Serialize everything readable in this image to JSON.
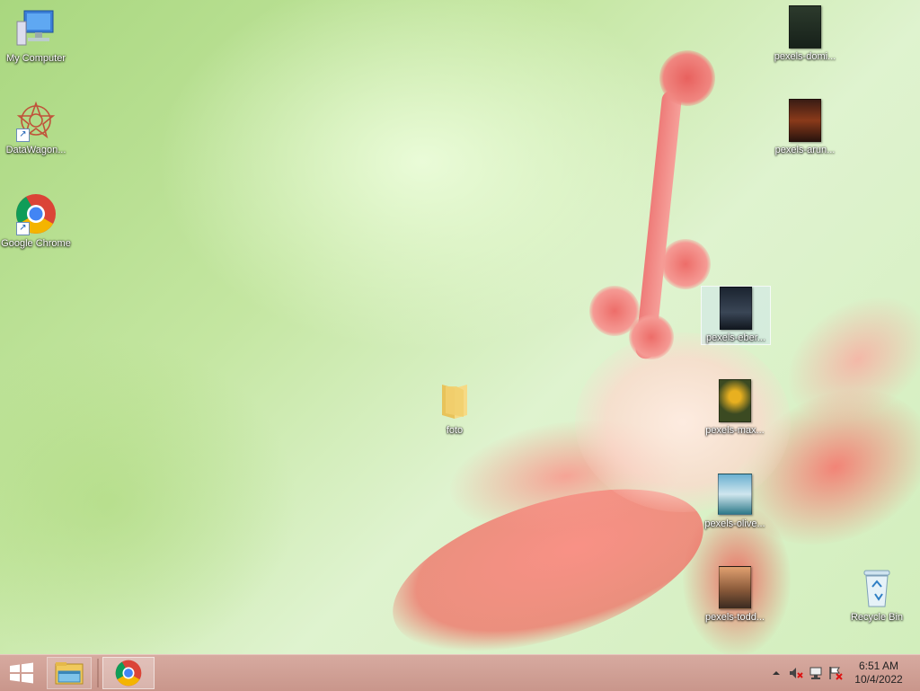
{
  "desktop": {
    "icons": {
      "my_computer": "My Computer",
      "datawagon": "DataWagon...",
      "chrome": "Google Chrome",
      "foto": "foto",
      "pexels_domi": "pexels-domi...",
      "pexels_arun": "pexels-arun...",
      "pexels_eber": "pexels-eber...",
      "pexels_max": "pexels-max...",
      "pexels_olive": "pexels-olive...",
      "pexels_todd": "pexels-todd...",
      "recycle_bin": "Recycle Bin"
    }
  },
  "taskbar": {
    "clock": {
      "time": "6:51 AM",
      "date": "10/4/2022"
    },
    "start_icon": "windows-logo-icon",
    "pinned": [
      "file-explorer-icon",
      "chrome-icon"
    ]
  }
}
